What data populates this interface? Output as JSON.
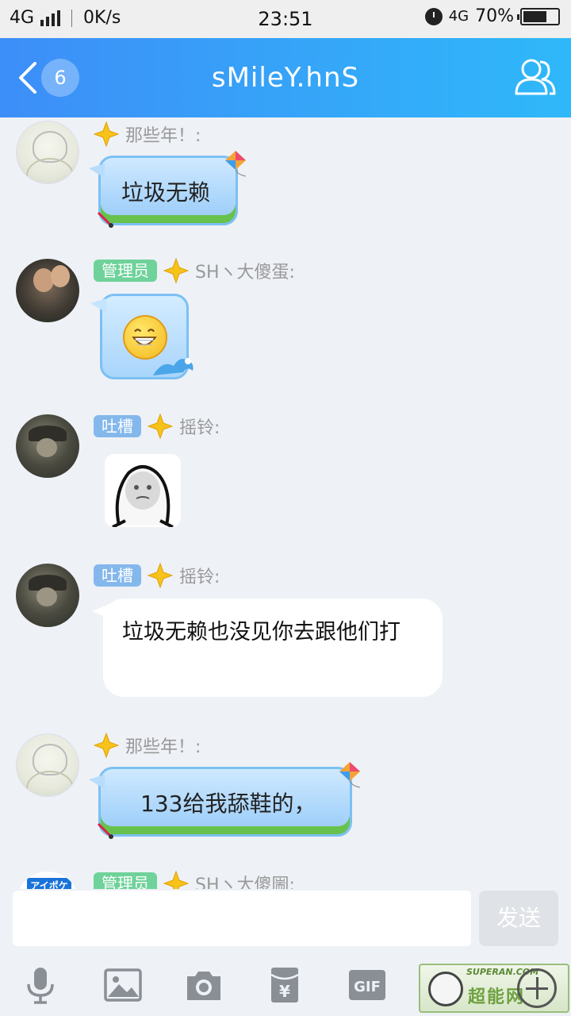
{
  "status_bar": {
    "network": "4G",
    "speed": "0K/s",
    "time": "23:51",
    "network_right": "4G",
    "battery": "70%",
    "battery_level": 0.7
  },
  "header": {
    "unread_count": "6",
    "title": "sMileY.hnS",
    "back_icon": "chevron-left-icon",
    "group_icon": "group-members-icon"
  },
  "messages": [
    {
      "sender": "那些年！:",
      "tag": "",
      "text": "垃圾无赖",
      "style": "kite-bubble"
    },
    {
      "sender": "SHヽ大傻蛋:",
      "tag": "管理员",
      "text": "",
      "style": "emoji-bubble",
      "content_icon": "grinning-face-icon"
    },
    {
      "sender": "摇铃:",
      "tag": "吐槽",
      "text": "",
      "style": "sticker",
      "content_icon": "meme-face-sticker"
    },
    {
      "sender": "摇铃:",
      "tag": "吐槽",
      "text": "垃圾无赖也没见你去跟他们打",
      "style": "plain-bubble"
    },
    {
      "sender": "那些年！:",
      "tag": "",
      "text": "133给我舔鞋的，",
      "style": "kite-bubble"
    },
    {
      "sender": "SHヽ大傻圌:",
      "tag": "管理员",
      "text": "",
      "style": "partial"
    }
  ],
  "avatar_logo_text": "アイポケ",
  "composer": {
    "input_value": "",
    "send_label": "发送"
  },
  "toolbar": {
    "items": [
      "microphone-icon",
      "image-icon",
      "camera-icon",
      "red-packet-icon",
      "gif-icon",
      "plus-icon"
    ],
    "gif_label": "GIF",
    "red_packet_label": "¥"
  },
  "watermark": {
    "top_text": "SUPERAN.COM",
    "main_text": "超能网"
  },
  "colors": {
    "header_start": "#3d8ef8",
    "header_end": "#2fb8f9",
    "admin_tag": "#6fd29a",
    "complain_tag": "#84b8ec",
    "chat_bg": "#eef1f6"
  }
}
